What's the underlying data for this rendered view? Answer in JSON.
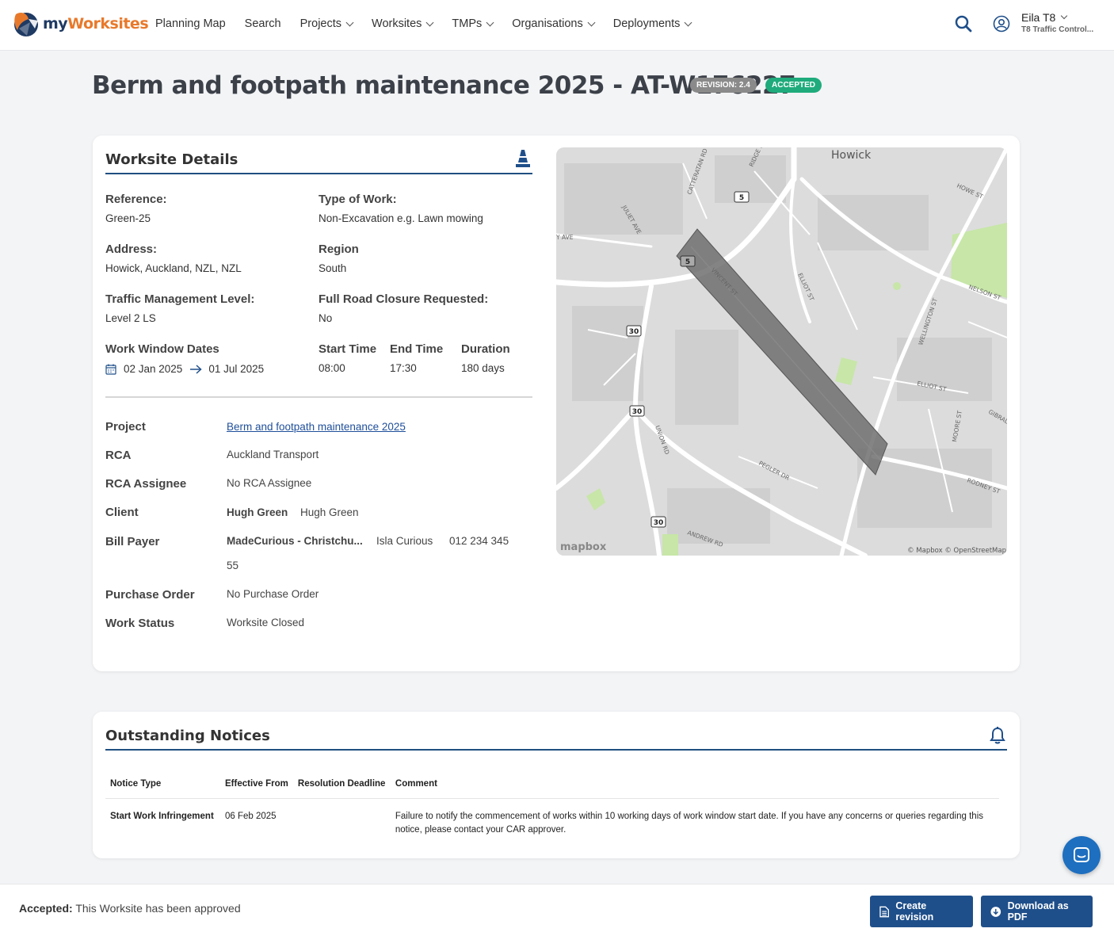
{
  "nav": {
    "logo_my": "my",
    "logo_worksites": "Worksites",
    "links": [
      {
        "label": "Planning Map",
        "dropdown": false
      },
      {
        "label": "Search",
        "dropdown": false
      },
      {
        "label": "Projects",
        "dropdown": true
      },
      {
        "label": "Worksites",
        "dropdown": true
      },
      {
        "label": "TMPs",
        "dropdown": true
      },
      {
        "label": "Organisations",
        "dropdown": true
      },
      {
        "label": "Deployments",
        "dropdown": true
      }
    ],
    "user_name": "Eila T8",
    "user_org": "T8 Traffic Control..."
  },
  "page": {
    "title": "Berm and footpath maintenance 2025 - AT-W176227",
    "revision_badge": "REVISION: 2.4",
    "status_badge": "ACCEPTED",
    "status_badge_color": "#1fab7c"
  },
  "details": {
    "section_title": "Worksite Details",
    "reference_label": "Reference:",
    "reference": "Green-25",
    "type_of_work_label": "Type of Work:",
    "type_of_work": "Non-Excavation e.g. Lawn mowing",
    "address_label": "Address:",
    "address": "Howick, Auckland, NZL, NZL",
    "region_label": "Region",
    "region": "South",
    "tm_level_label": "Traffic Management Level:",
    "tm_level": "Level 2 LS",
    "road_closure_label": "Full Road Closure Requested:",
    "road_closure": "No",
    "work_window_label": "Work Window Dates",
    "work_window_start": "02 Jan 2025",
    "work_window_end": "01 Jul 2025",
    "start_time_label": "Start Time",
    "start_time": "08:00",
    "end_time_label": "End Time",
    "end_time": "17:30",
    "duration_label": "Duration",
    "duration": "180 days",
    "project_label": "Project",
    "project": "Berm and footpath maintenance 2025",
    "rca_label": "RCA",
    "rca": "Auckland Transport",
    "rca_assignee_label": "RCA Assignee",
    "rca_assignee": "No RCA Assignee",
    "client_label": "Client",
    "client_org": "Hugh Green",
    "client_contact": "Hugh Green",
    "bill_payer_label": "Bill Payer",
    "bill_payer_org": "MadeCurious - Christchu...",
    "bill_payer_contact": "Isla Curious",
    "bill_payer_phone": "012 234 345",
    "bill_payer_phone_cont": "55",
    "purchase_order_label": "Purchase Order",
    "purchase_order": "No Purchase Order",
    "work_status_label": "Work Status",
    "work_status": "Worksite Closed"
  },
  "map": {
    "place_label": "Howick",
    "streets": [
      "VINCENT ST",
      "ELLIOT ST",
      "WELLINGTON ST",
      "NELSON ST",
      "HOWE ST",
      "UNION RD",
      "PEGLER DR",
      "ANDREW RD",
      "RODNEY ST",
      "MOORE ST",
      "GIBRALTAR",
      "JULIET AVE",
      "RIDGE RD",
      "CATTERATAN RD",
      "Y AVE",
      "ELLIOT ST"
    ],
    "route_shields": [
      "5",
      "5",
      "30",
      "30",
      "30"
    ],
    "attribution": "© Mapbox © OpenStreetMap",
    "logo": "mapbox"
  },
  "notices": {
    "section_title": "Outstanding Notices",
    "columns": [
      "Notice Type",
      "Effective From",
      "Resolution Deadline",
      "Comment"
    ],
    "rows": [
      {
        "type": "Start Work Infringement",
        "effective_from": "06 Feb 2025",
        "resolution_deadline": "",
        "comment": "Failure to notify the commencement of works within 10 working days of work window start date. If you have any concerns or queries regarding this notice, please contact your CAR approver."
      }
    ]
  },
  "footer": {
    "status_label": "Accepted:",
    "status_text": " This Worksite has been approved",
    "create_revision": "Create revision",
    "download_pdf": "Download as PDF"
  },
  "colors": {
    "primary": "#1f4f8a",
    "accent_orange": "#e8792b",
    "accepted_green": "#1fab7c"
  }
}
